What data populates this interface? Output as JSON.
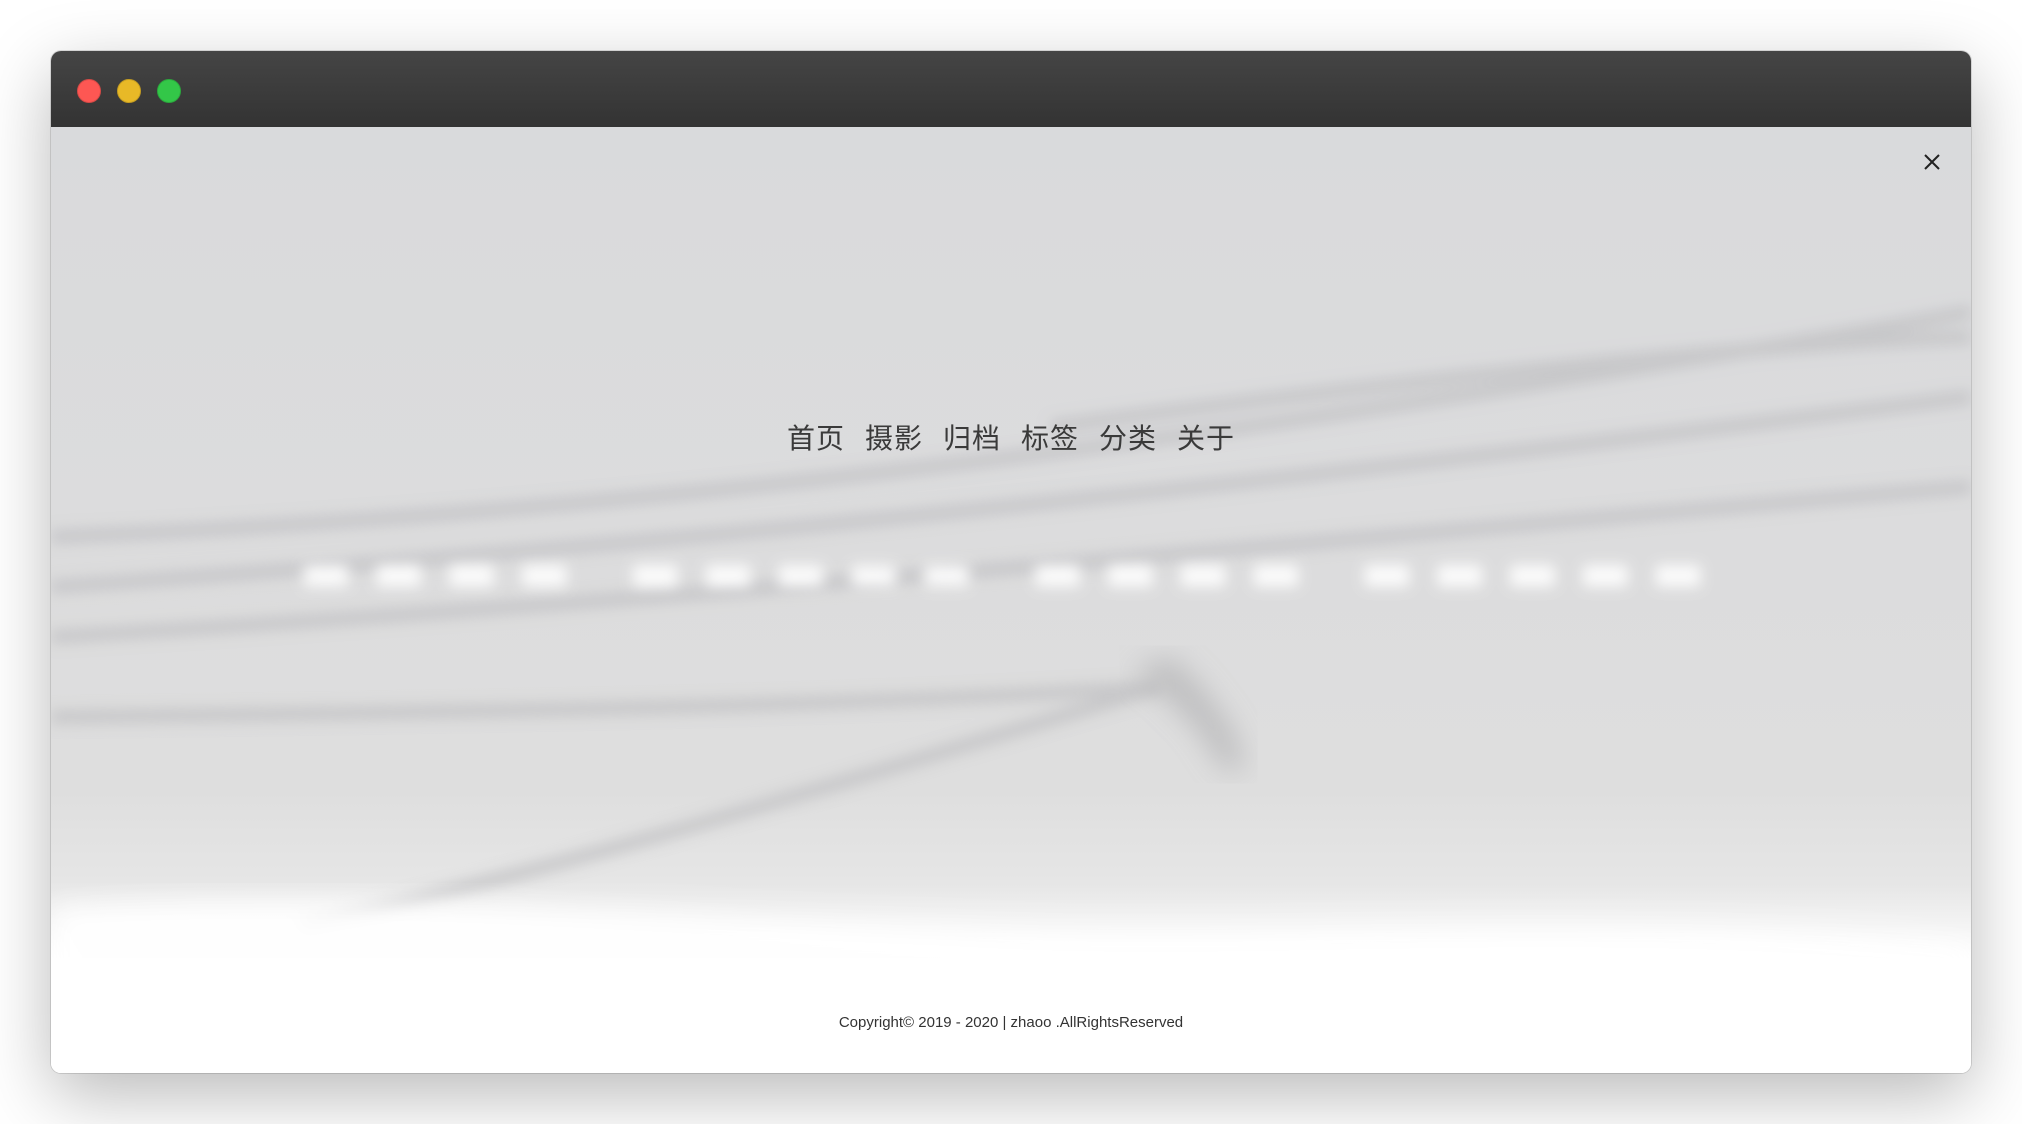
{
  "window": {
    "traffic_lights": [
      "close",
      "minimize",
      "zoom"
    ]
  },
  "nav": {
    "items": [
      {
        "label": "首页"
      },
      {
        "label": "摄影"
      },
      {
        "label": "归档"
      },
      {
        "label": "标签"
      },
      {
        "label": "分类"
      },
      {
        "label": "关于"
      }
    ]
  },
  "overlay": {
    "close_icon": "close-icon"
  },
  "footer": {
    "copyright": "Copyright© 2019 - 2020 | zhaoo .AllRightsReserved"
  },
  "colors": {
    "titlebar": "#3b3b3b",
    "close": "#fd5753",
    "minimize": "#e8b927",
    "zoom": "#33c748",
    "nav_text": "#3a3a3a"
  }
}
